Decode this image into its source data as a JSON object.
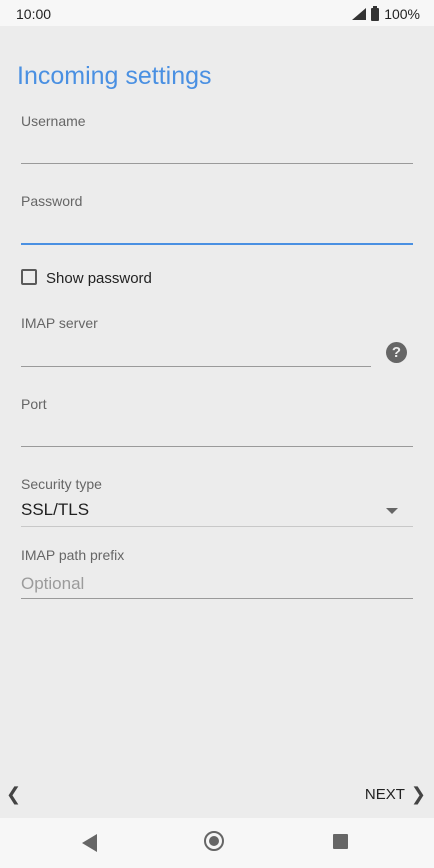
{
  "status_bar": {
    "time": "10:00",
    "battery": "100%",
    "icons": [
      "signal-icon",
      "battery-icon"
    ]
  },
  "page": {
    "title": "Incoming settings"
  },
  "form": {
    "username": {
      "label": "Username",
      "value": ""
    },
    "password": {
      "label": "Password",
      "value": ""
    },
    "show_password": {
      "label": "Show password",
      "checked": false
    },
    "imap_server": {
      "label": "IMAP server",
      "value": ""
    },
    "port": {
      "label": "Port",
      "value": ""
    },
    "security_type": {
      "label": "Security type",
      "value": "SSL/TLS"
    },
    "imap_path_prefix": {
      "label": "IMAP path prefix",
      "placeholder": "Optional",
      "value": ""
    }
  },
  "footer": {
    "next_label": "NEXT"
  },
  "colors": {
    "accent": "#4a90e2",
    "background": "#ececec"
  }
}
